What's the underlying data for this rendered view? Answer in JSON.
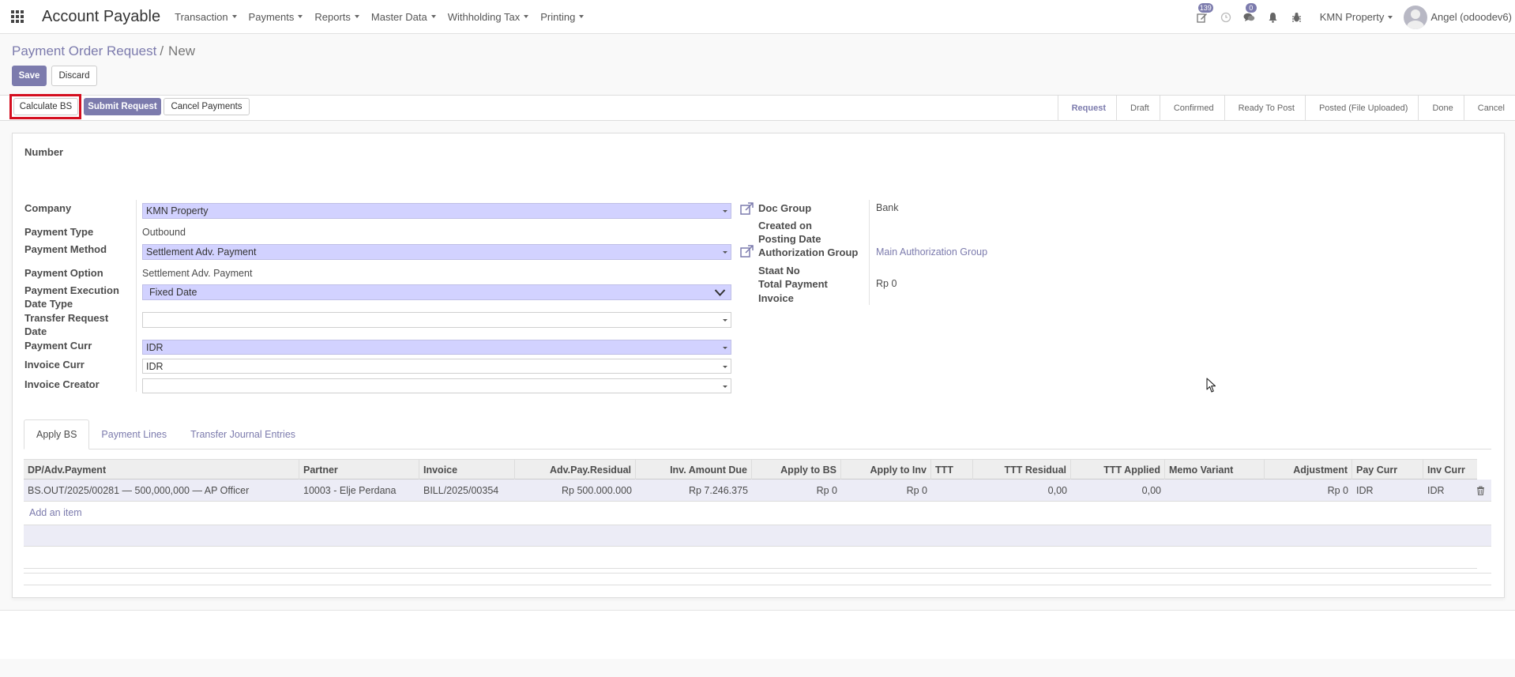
{
  "navbar": {
    "app_title": "Account Payable",
    "menu": [
      {
        "label": "Transaction"
      },
      {
        "label": "Payments"
      },
      {
        "label": "Reports"
      },
      {
        "label": "Master Data"
      },
      {
        "label": "Withholding Tax"
      },
      {
        "label": "Printing"
      }
    ],
    "activity_count": "139",
    "messages_count": "0",
    "company": "KMN Property",
    "user": "Angel (odoodev6)"
  },
  "breadcrumb": {
    "parent": "Payment Order Request",
    "separator": "/",
    "current": "New"
  },
  "actions": {
    "save_label": "Save",
    "discard_label": "Discard"
  },
  "header_buttons": {
    "calculate_bs": "Calculate BS",
    "submit_request": "Submit Request",
    "cancel_payments": "Cancel Payments"
  },
  "statusbar": {
    "stages": [
      "Request",
      "Draft",
      "Confirmed",
      "Ready To Post",
      "Posted (File Uploaded)",
      "Done",
      "Cancel"
    ],
    "active_stage": "Request"
  },
  "form": {
    "number_label": "Number",
    "company_label": "Company",
    "company_value": "KMN Property",
    "payment_type_label": "Payment Type",
    "payment_type_value": "Outbound",
    "payment_method_label": "Payment Method",
    "payment_method_value": "Settlement Adv. Payment",
    "payment_option_label": "Payment Option",
    "payment_option_value": "Settlement Adv. Payment",
    "exec_date_type_label_1": "Payment Execution",
    "exec_date_type_label_2": "Date Type",
    "exec_date_type_value": "Fixed Date",
    "transfer_request_label_1": "Transfer Request",
    "transfer_request_label_2": "Date",
    "transfer_request_value": "",
    "payment_curr_label": "Payment Curr",
    "payment_curr_value": "IDR",
    "invoice_curr_label": "Invoice Curr",
    "invoice_curr_value": "IDR",
    "invoice_creator_label": "Invoice Creator",
    "invoice_creator_value": "",
    "doc_group_label": "Doc Group",
    "doc_group_value": "Bank",
    "created_on_label": "Created on",
    "posting_date_label": "Posting Date",
    "auth_group_label": "Authorization Group",
    "auth_group_value": "Main Authorization Group",
    "staat_no_label": "Staat No",
    "total_payment_label": "Total Payment",
    "total_payment_value": "Rp 0",
    "invoice_label": "Invoice"
  },
  "tabs": [
    "Apply BS",
    "Payment Lines",
    "Transfer Journal Entries"
  ],
  "table": {
    "columns": [
      "DP/Adv.Payment",
      "Partner",
      "Invoice",
      "Adv.Pay.Residual",
      "Inv. Amount Due",
      "Apply to BS",
      "Apply to Inv",
      "TTT",
      "TTT Residual",
      "TTT Applied",
      "Memo Variant",
      "Adjustment",
      "Pay Curr",
      "Inv Curr"
    ],
    "rows": [
      [
        "BS.OUT/2025/00281 — 500,000,000 — AP Officer",
        "10003 - Elje Perdana",
        "BILL/2025/00354",
        "Rp 500.000.000",
        "Rp 7.246.375",
        "Rp 0",
        "Rp 0",
        "",
        "0,00",
        "0,00",
        "",
        "Rp 0",
        "IDR",
        "IDR"
      ]
    ],
    "add_item_label": "Add an item"
  },
  "colors": {
    "accent": "#7c7bad",
    "required_field": "#d2d2ff",
    "highlight": "#d40e1f"
  }
}
